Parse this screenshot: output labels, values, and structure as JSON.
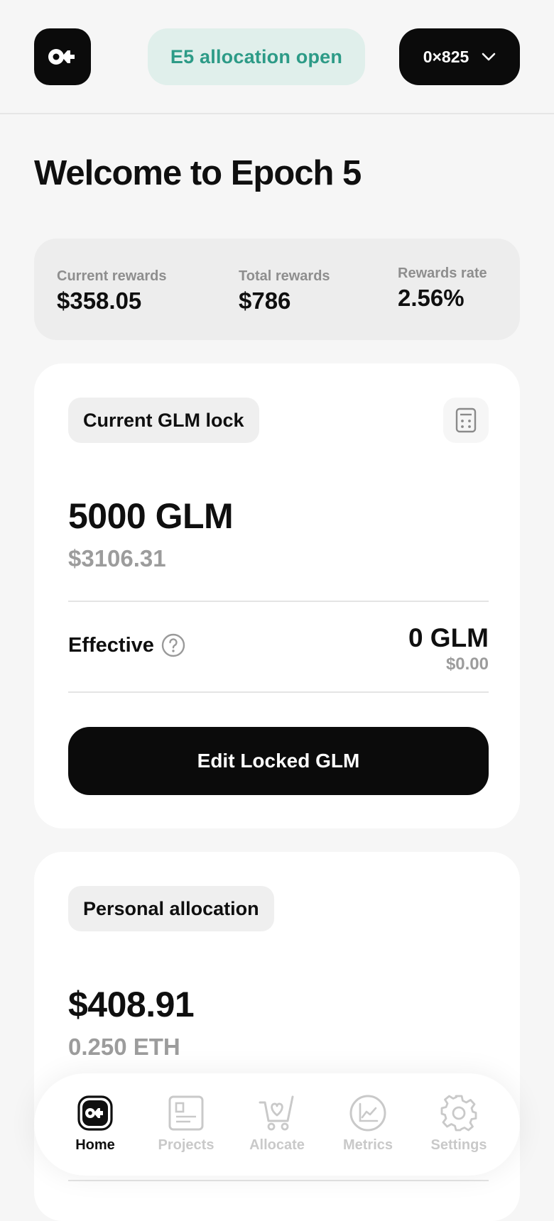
{
  "header": {
    "allocation_status": "E5 allocation open",
    "wallet_address": "0×825"
  },
  "page": {
    "title": "Welcome to Epoch 5"
  },
  "rewards": {
    "current": {
      "label": "Current rewards",
      "value": "$358.05"
    },
    "total": {
      "label": "Total rewards",
      "value": "$786"
    },
    "rate": {
      "label": "Rewards rate",
      "value": "2.56%"
    }
  },
  "glm_lock": {
    "tag": "Current GLM lock",
    "amount": "5000 GLM",
    "usd": "$3106.31",
    "effective_label": "Effective",
    "effective_glm": "0 GLM",
    "effective_usd": "$0.00",
    "edit_button": "Edit Locked GLM"
  },
  "personal_allocation": {
    "tag": "Personal allocation",
    "usd": "$408.91",
    "eth": "0.250 ETH"
  },
  "nav": {
    "items": [
      {
        "label": "Home",
        "icon": "home-logo-icon",
        "active": true
      },
      {
        "label": "Projects",
        "icon": "projects-icon",
        "active": false
      },
      {
        "label": "Allocate",
        "icon": "cart-heart-icon",
        "active": false
      },
      {
        "label": "Metrics",
        "icon": "chart-icon",
        "active": false
      },
      {
        "label": "Settings",
        "icon": "gear-icon",
        "active": false
      }
    ]
  },
  "colors": {
    "accent_green": "#2d9b87",
    "pill_green_bg": "#e0efeb",
    "dark": "#0b0b0b",
    "muted": "#9c9c9c"
  }
}
